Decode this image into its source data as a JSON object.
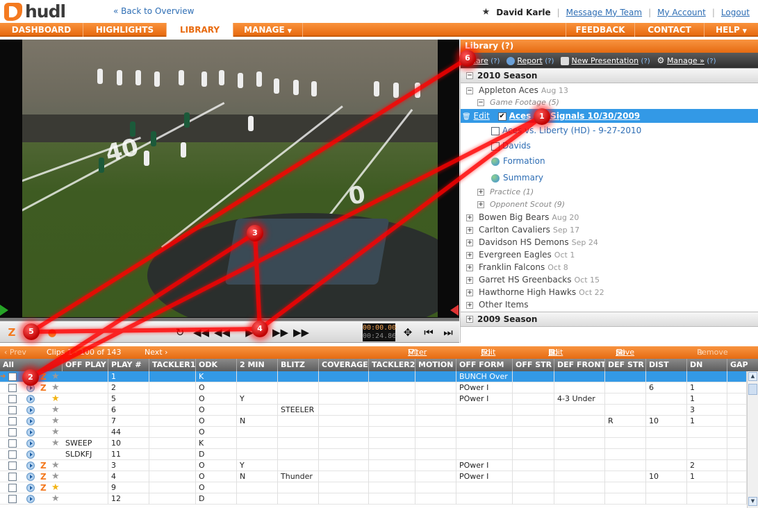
{
  "header": {
    "logo_text": "hudl",
    "back_link": "« Back to Overview",
    "user_name": "David Karle",
    "links": [
      "Message My Team",
      "My Account",
      "Logout"
    ]
  },
  "nav": {
    "items": [
      "DASHBOARD",
      "HIGHLIGHTS",
      "LIBRARY",
      "MANAGE",
      "FEEDBACK",
      "CONTACT",
      "HELP"
    ],
    "active": "LIBRARY"
  },
  "player": {
    "time_current": "00:00.00",
    "time_total": "00:24.86",
    "yard_numbers": [
      "40",
      "0"
    ]
  },
  "library": {
    "title": "Library",
    "help": "(?)",
    "tools": [
      "Share",
      "Report",
      "New Presentation",
      "Manage »"
    ],
    "season_2010": "2010 Season",
    "season_2009": "2009 Season",
    "team_top": {
      "name": "Appleton Aces",
      "date": "Aug 13"
    },
    "game_footage": "Game Footage (5)",
    "edit_label": "Edit",
    "selected_item": "Aces vs. Signals 10/30/2009",
    "footage_items": [
      "Aces vs. Liberty (HD) - 9-27-2010",
      "Davids",
      "Formation",
      "Summary"
    ],
    "practice": "Practice (1)",
    "opponent_scout": "Opponent Scout (9)",
    "teams": [
      {
        "name": "Bowen Big Bears",
        "date": "Aug 20"
      },
      {
        "name": "Carlton Cavaliers",
        "date": "Sep 17"
      },
      {
        "name": "Davidson HS Demons",
        "date": "Sep 24"
      },
      {
        "name": "Evergreen Eagles",
        "date": "Oct 1"
      },
      {
        "name": "Franklin Falcons",
        "date": "Oct 8"
      },
      {
        "name": "Garret HS Greenbacks",
        "date": "Oct 15"
      },
      {
        "name": "Hawthorne High Hawks",
        "date": "Oct 22"
      },
      {
        "name": "Other Items",
        "date": ""
      }
    ]
  },
  "gridbar": {
    "prev": "‹ Prev",
    "clips": "Clips 1 - 100 of 143",
    "next": "Next ›",
    "actions": [
      "Filter Clips",
      "Edit Data",
      "Edit View",
      "Save Playlist",
      "Remove Clip"
    ],
    "help": "(?)"
  },
  "table": {
    "columns": [
      "All",
      "OFF PLAY",
      "PLAY #",
      "TACKLER1",
      "ODK",
      "2 MIN",
      "BLITZ",
      "COVERAGE",
      "TACKLER2",
      "MOTION",
      "OFF FORM",
      "OFF STR",
      "DEF FRONT",
      "DEF STR",
      "DIST",
      "DN",
      "GAP"
    ],
    "rows": [
      {
        "off_play": "",
        "play": "1",
        "tackler1": "",
        "odk": "K",
        "two_min": "",
        "blitz": "",
        "coverage": "",
        "tackler2": "",
        "motion": "",
        "off_form": "BUNCH Over",
        "off_str": "",
        "def_front": "",
        "def_str": "",
        "dist": "",
        "dn": "",
        "gap": "",
        "hudl": true,
        "star": "gray"
      },
      {
        "off_play": "",
        "play": "2",
        "tackler1": "",
        "odk": "O",
        "two_min": "",
        "blitz": "",
        "coverage": "",
        "tackler2": "",
        "motion": "",
        "off_form": "POwer I",
        "off_str": "",
        "def_front": "",
        "def_str": "",
        "dist": "6",
        "dn": "1",
        "gap": "",
        "hudl": true,
        "star": "gray"
      },
      {
        "off_play": "",
        "play": "5",
        "tackler1": "",
        "odk": "O",
        "two_min": "Y",
        "blitz": "",
        "coverage": "",
        "tackler2": "",
        "motion": "",
        "off_form": "POwer I",
        "off_str": "",
        "def_front": "4-3 Under",
        "def_str": "",
        "dist": "",
        "dn": "1",
        "gap": "",
        "hudl": false,
        "star": "gold"
      },
      {
        "off_play": "",
        "play": "6",
        "tackler1": "",
        "odk": "O",
        "two_min": "",
        "blitz": "STEELER",
        "coverage": "",
        "tackler2": "",
        "motion": "",
        "off_form": "",
        "off_str": "",
        "def_front": "",
        "def_str": "",
        "dist": "",
        "dn": "3",
        "gap": "",
        "hudl": false,
        "star": "gray"
      },
      {
        "off_play": "",
        "play": "7",
        "tackler1": "",
        "odk": "O",
        "two_min": "N",
        "blitz": "",
        "coverage": "",
        "tackler2": "",
        "motion": "",
        "off_form": "",
        "off_str": "",
        "def_front": "",
        "def_str": "R",
        "dist": "10",
        "dn": "1",
        "gap": "",
        "hudl": false,
        "star": "gray"
      },
      {
        "off_play": "",
        "play": "44",
        "tackler1": "",
        "odk": "O",
        "two_min": "",
        "blitz": "",
        "coverage": "",
        "tackler2": "",
        "motion": "",
        "off_form": "",
        "off_str": "",
        "def_front": "",
        "def_str": "",
        "dist": "",
        "dn": "",
        "gap": "",
        "hudl": false,
        "star": "gray"
      },
      {
        "off_play": "SWEEP",
        "play": "10",
        "tackler1": "",
        "odk": "K",
        "two_min": "",
        "blitz": "",
        "coverage": "",
        "tackler2": "",
        "motion": "",
        "off_form": "",
        "off_str": "",
        "def_front": "",
        "def_str": "",
        "dist": "",
        "dn": "",
        "gap": "",
        "hudl": false,
        "star": "gray"
      },
      {
        "off_play": "SLDKFJ",
        "play": "11",
        "tackler1": "",
        "odk": "D",
        "two_min": "",
        "blitz": "",
        "coverage": "",
        "tackler2": "",
        "motion": "",
        "off_form": "",
        "off_str": "",
        "def_front": "",
        "def_str": "",
        "dist": "",
        "dn": "",
        "gap": "",
        "hudl": false,
        "star": "none"
      },
      {
        "off_play": "",
        "play": "3",
        "tackler1": "",
        "odk": "O",
        "two_min": "Y",
        "blitz": "",
        "coverage": "",
        "tackler2": "",
        "motion": "",
        "off_form": "POwer I",
        "off_str": "",
        "def_front": "",
        "def_str": "",
        "dist": "",
        "dn": "2",
        "gap": "",
        "hudl": true,
        "star": "gray"
      },
      {
        "off_play": "",
        "play": "4",
        "tackler1": "",
        "odk": "O",
        "two_min": "N",
        "blitz": "Thunder",
        "coverage": "",
        "tackler2": "",
        "motion": "",
        "off_form": "POwer I",
        "off_str": "",
        "def_front": "",
        "def_str": "",
        "dist": "10",
        "dn": "1",
        "gap": "",
        "hudl": true,
        "star": "gray"
      },
      {
        "off_play": "",
        "play": "9",
        "tackler1": "",
        "odk": "O",
        "two_min": "",
        "blitz": "",
        "coverage": "",
        "tackler2": "",
        "motion": "",
        "off_form": "",
        "off_str": "",
        "def_front": "",
        "def_str": "",
        "dist": "",
        "dn": "",
        "gap": "",
        "hudl": true,
        "star": "gold"
      },
      {
        "off_play": "",
        "play": "12",
        "tackler1": "",
        "odk": "D",
        "two_min": "",
        "blitz": "",
        "coverage": "",
        "tackler2": "",
        "motion": "",
        "off_form": "",
        "off_str": "",
        "def_front": "",
        "def_str": "",
        "dist": "",
        "dn": "",
        "gap": "",
        "hudl": false,
        "star": "gray"
      }
    ]
  },
  "annotations": [
    "1",
    "2",
    "3",
    "4",
    "5",
    "6"
  ],
  "colors": {
    "accent": "#f47a20",
    "selection": "#3399e6",
    "link": "#2d6db4",
    "annotation": "#e00000"
  }
}
